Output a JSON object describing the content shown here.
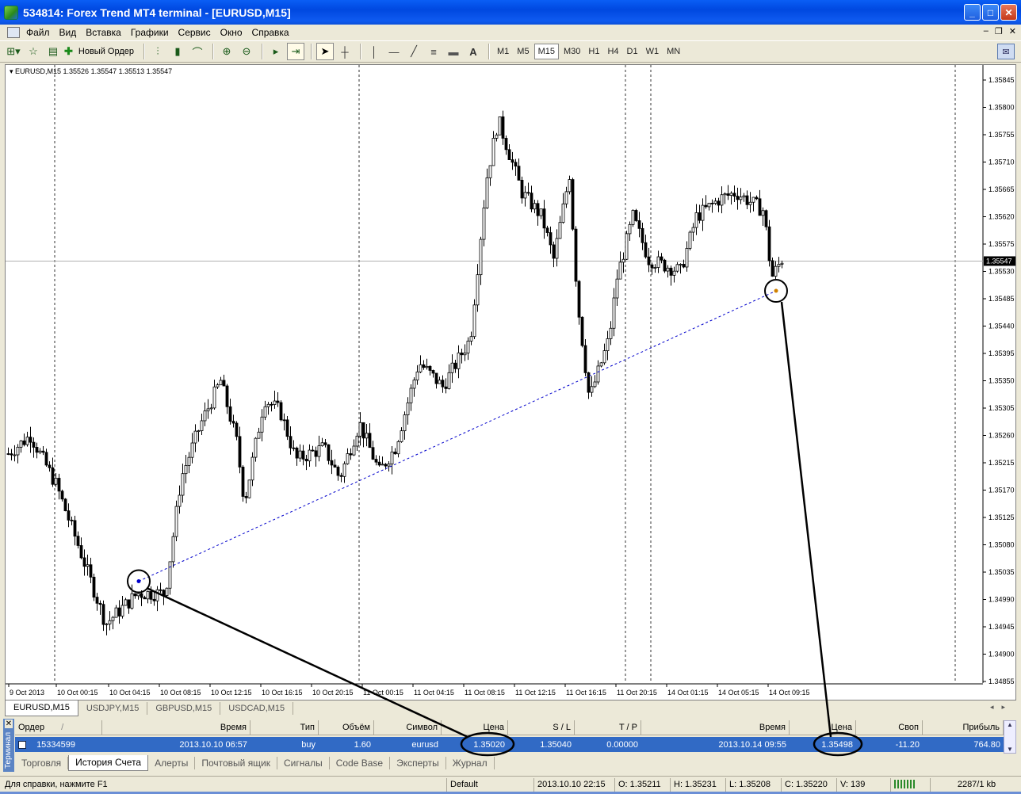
{
  "window": {
    "title": "534814: Forex Trend MT4 terminal - [EURUSD,M15]"
  },
  "menu": [
    "Файл",
    "Вид",
    "Вставка",
    "Графики",
    "Сервис",
    "Окно",
    "Справка"
  ],
  "toolbar": {
    "new_order_label": "Новый Ордер",
    "text_tool_label": "A",
    "timeframes": [
      "M1",
      "M5",
      "M15",
      "M30",
      "H1",
      "H4",
      "D1",
      "W1",
      "MN"
    ],
    "active_timeframe": "M15"
  },
  "chart": {
    "symbol_header": "EURUSD,M15  1.35526 1.35547 1.35513 1.35547",
    "current_price": "1.35547",
    "price_labels": [
      "1.35845",
      "1.35800",
      "1.35755",
      "1.35710",
      "1.35665",
      "1.35620",
      "1.35575",
      "1.35530",
      "1.35485",
      "1.35440",
      "1.35395",
      "1.35350",
      "1.35305",
      "1.35260",
      "1.35215",
      "1.35170",
      "1.35125",
      "1.35080",
      "1.35035",
      "1.34990",
      "1.34945",
      "1.34900",
      "1.34855"
    ],
    "time_labels": [
      "9 Oct 2013",
      "10 Oct 00:15",
      "10 Oct 04:15",
      "10 Oct 08:15",
      "10 Oct 12:15",
      "10 Oct 16:15",
      "10 Oct 20:15",
      "11 Oct 00:15",
      "11 Oct 04:15",
      "11 Oct 08:15",
      "11 Oct 12:15",
      "11 Oct 16:15",
      "11 Oct 20:15",
      "14 Oct 01:15",
      "14 Oct 05:15",
      "14 Oct 09:15"
    ]
  },
  "chart_tabs": [
    "EURUSD,M15",
    "USDJPY,M15",
    "GBPUSD,M15",
    "USDCAD,M15"
  ],
  "terminal": {
    "side_label": "Терминал",
    "columns": {
      "order": "Ордер",
      "sort": "/",
      "open_time": "Время",
      "type": "Тип",
      "volume": "Объём",
      "symbol": "Символ",
      "open_price": "Цена",
      "sl": "S / L",
      "tp": "T / P",
      "close_time": "Время",
      "close_price": "Цена",
      "swap": "Своп",
      "profit": "Прибыль"
    },
    "row": {
      "order": "15334599",
      "open_time": "2013.10.10 06:57",
      "type": "buy",
      "volume": "1.60",
      "symbol": "eurusd",
      "open_price": "1.35020",
      "sl": "1.35040",
      "tp": "0.00000",
      "close_time": "2013.10.14 09:55",
      "close_price": "1.35498",
      "swap": "-11.20",
      "profit": "764.80"
    },
    "tabs": [
      "Торговля",
      "История Счета",
      "Алерты",
      "Почтовый ящик",
      "Сигналы",
      "Code Base",
      "Эксперты",
      "Журнал"
    ],
    "active_tab": "История Счета"
  },
  "status": {
    "help": "Для справки, нажмите F1",
    "profile": "Default",
    "datetime": "2013.10.10 22:15",
    "open": "O: 1.35211",
    "high": "H: 1.35231",
    "low": "L: 1.35208",
    "close": "C: 1.35220",
    "volume": "V: 139",
    "traffic": "2287/1 kb"
  },
  "chart_data": {
    "type": "candlestick",
    "symbol": "EURUSD",
    "timeframe": "M15",
    "ylim": [
      1.34855,
      1.35845
    ],
    "last_ohlc": {
      "open": 1.35526,
      "high": 1.35547,
      "low": 1.35513,
      "close": 1.35547
    },
    "x": [
      "9 Oct 2013",
      "10 Oct 00:15",
      "10 Oct 04:15",
      "10 Oct 08:15",
      "10 Oct 12:15",
      "10 Oct 16:15",
      "10 Oct 20:15",
      "11 Oct 00:15",
      "11 Oct 04:15",
      "11 Oct 08:15",
      "11 Oct 12:15",
      "11 Oct 16:15",
      "11 Oct 20:15",
      "14 Oct 01:15",
      "14 Oct 05:15",
      "14 Oct 09:15"
    ],
    "close_approx": [
      1.3522,
      1.3508,
      1.3502,
      1.3525,
      1.3532,
      1.3536,
      1.3521,
      1.3526,
      1.3538,
      1.3574,
      1.3558,
      1.3534,
      1.3556,
      1.3564,
      1.3566,
      1.3553
    ],
    "trade": {
      "open_time": "2013.10.10 06:57",
      "open_price": 1.3502,
      "close_time": "2013.10.14 09:55",
      "close_price": 1.35498,
      "type": "buy"
    }
  }
}
